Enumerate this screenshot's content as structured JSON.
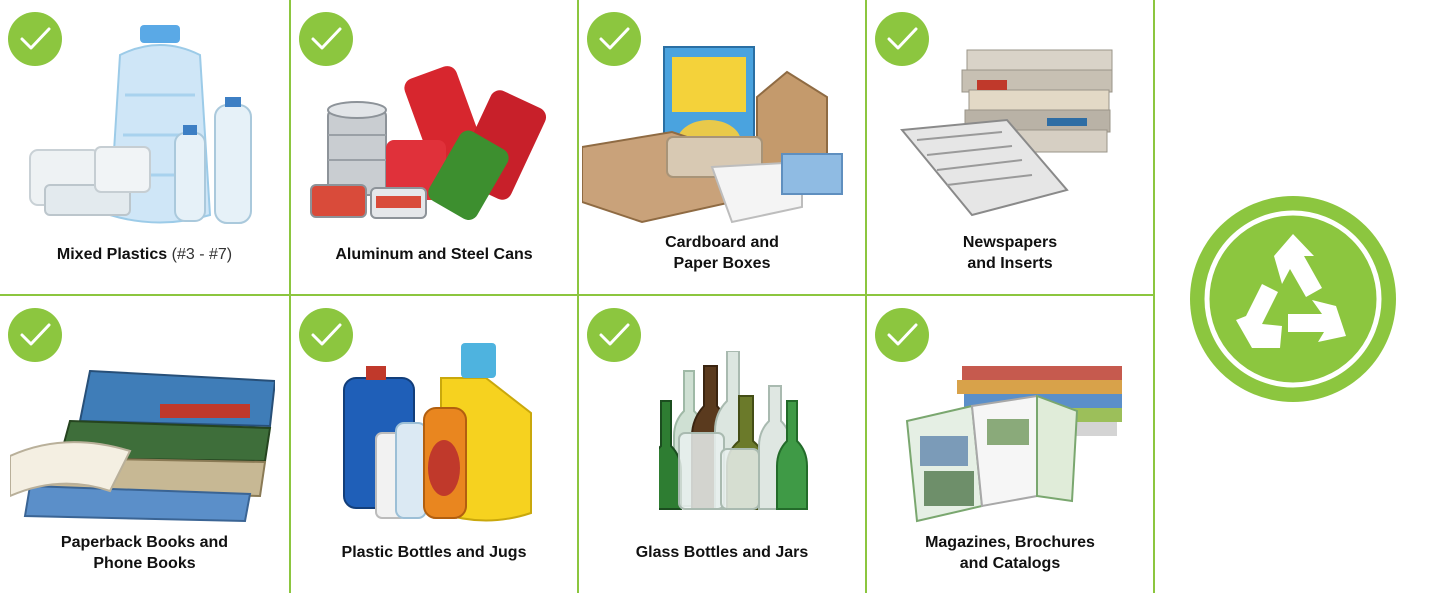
{
  "colors": {
    "accent": "#8cc63f",
    "text": "#111111"
  },
  "items": [
    {
      "label": "Mixed Plastics",
      "suffix": " (#3 - #7)",
      "icon": "check-icon"
    },
    {
      "label": "Aluminum and Steel Cans",
      "icon": "check-icon"
    },
    {
      "label_line1": "Cardboard and",
      "label_line2": "Paper Boxes",
      "icon": "check-icon"
    },
    {
      "label_line1": "Newspapers",
      "label_line2": "and Inserts",
      "icon": "check-icon"
    },
    {
      "label_line1": "Paperback Books and",
      "label_line2": "Phone Books",
      "icon": "check-icon"
    },
    {
      "label": "Plastic Bottles and Jugs",
      "icon": "check-icon"
    },
    {
      "label": "Glass Bottles and Jars",
      "icon": "check-icon"
    },
    {
      "label_line1": "Magazines, Brochures",
      "label_line2": "and Catalogs",
      "icon": "check-icon"
    }
  ],
  "badge": {
    "icon": "recycle-icon"
  }
}
